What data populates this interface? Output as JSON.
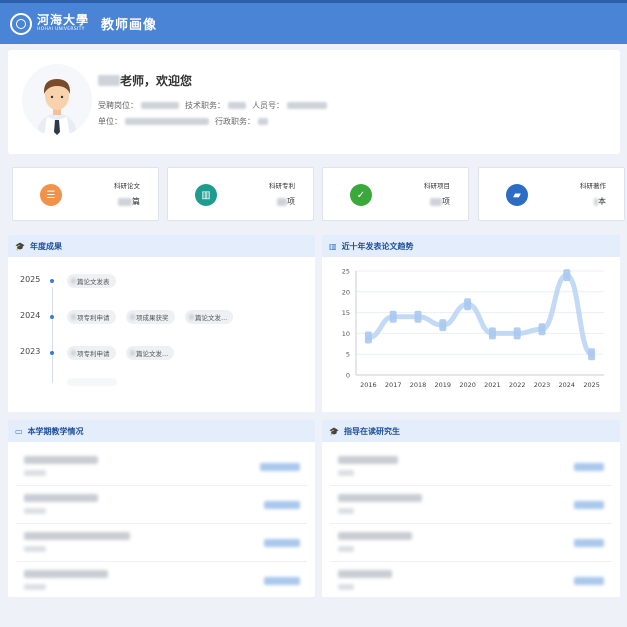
{
  "header": {
    "logo_cn": "河海大學",
    "logo_en": "HOHAI UNIVERSITY",
    "title": "教师画像"
  },
  "profile": {
    "greeting_suffix": "老师，欢迎您",
    "label_position": "受聘岗位：",
    "label_tech_title": "技术职务：",
    "label_staff_id": "人员号：",
    "label_unit": "单位：",
    "label_admin_title": "行政职务："
  },
  "stats": [
    {
      "label": "科研论文",
      "unit": "篇",
      "color": "#f0924a",
      "icon": "list-icon"
    },
    {
      "label": "科研专利",
      "unit": "项",
      "color": "#1e9c8f",
      "icon": "bar-chart-icon"
    },
    {
      "label": "科研项目",
      "unit": "项",
      "color": "#3aa93a",
      "icon": "check-circle-icon"
    },
    {
      "label": "科研著作",
      "unit": "本",
      "color": "#2d6cc4",
      "icon": "folder-icon"
    }
  ],
  "annual": {
    "title": "年度成果",
    "years": [
      {
        "year": "2025",
        "tags": [
          "篇论文发表"
        ]
      },
      {
        "year": "2024",
        "tags": [
          "项专利申请",
          "项成果获奖",
          "篇论文发..."
        ]
      },
      {
        "year": "2023",
        "tags": [
          "项专利申请",
          "篇论文发..."
        ]
      }
    ]
  },
  "trend": {
    "title": "近十年发表论文趋势"
  },
  "chart_data": {
    "type": "line",
    "title": "",
    "x": [
      "2016",
      "2017",
      "2018",
      "2019",
      "2020",
      "2021",
      "2022",
      "2023",
      "2024",
      "2025"
    ],
    "values": [
      9,
      14,
      14,
      12,
      17,
      10,
      10,
      11,
      24,
      5
    ],
    "ylim": [
      0,
      25
    ],
    "yticks": [
      "0",
      "5",
      "10",
      "15",
      "20",
      "25"
    ],
    "grid": true,
    "color": "#b7d4f3"
  },
  "teaching": {
    "title": "本学期教学情况"
  },
  "students": {
    "title": "指导在读研究生"
  }
}
